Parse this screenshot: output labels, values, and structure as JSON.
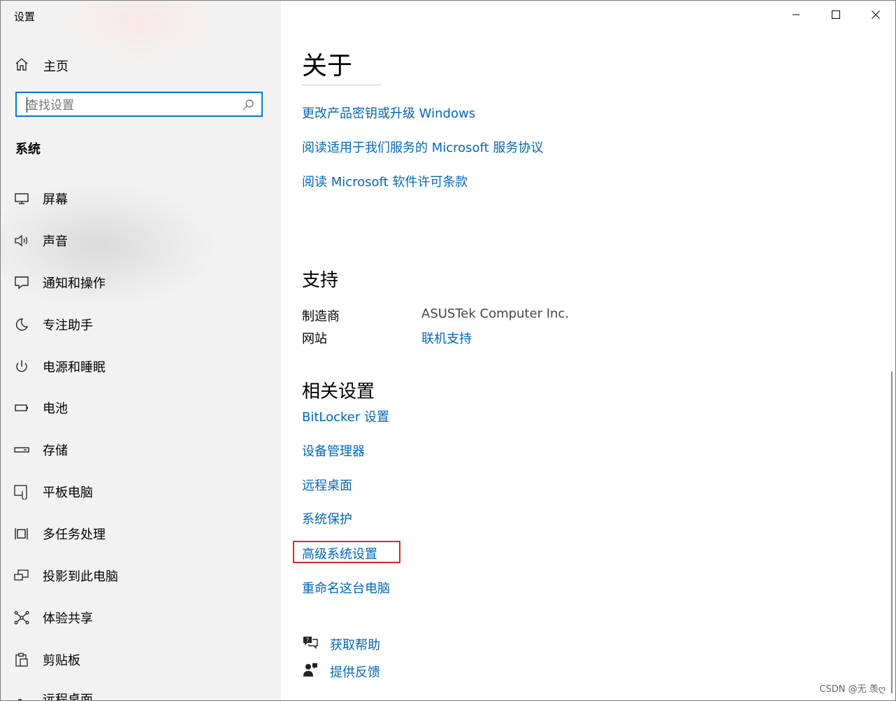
{
  "window": {
    "title": "设置",
    "controls": [
      "minimize",
      "maximize",
      "close"
    ]
  },
  "sidebar": {
    "home_label": "主页",
    "search_placeholder": "查找设置",
    "section_title": "系统",
    "items": [
      {
        "label": "屏幕",
        "icon": "display-icon"
      },
      {
        "label": "声音",
        "icon": "speaker-icon"
      },
      {
        "label": "通知和操作",
        "icon": "notification-icon"
      },
      {
        "label": "专注助手",
        "icon": "moon-icon"
      },
      {
        "label": "电源和睡眠",
        "icon": "power-icon"
      },
      {
        "label": "电池",
        "icon": "battery-icon"
      },
      {
        "label": "存储",
        "icon": "storage-icon"
      },
      {
        "label": "平板电脑",
        "icon": "tablet-icon"
      },
      {
        "label": "多任务处理",
        "icon": "multitask-icon"
      },
      {
        "label": "投影到此电脑",
        "icon": "project-icon"
      },
      {
        "label": "体验共享",
        "icon": "share-icon"
      },
      {
        "label": "剪贴板",
        "icon": "clipboard-icon"
      },
      {
        "label": "远程桌面",
        "icon": "remote-desktop-icon"
      }
    ]
  },
  "main": {
    "about_title": "关于",
    "about_links": [
      "更改产品密钥或升级 Windows",
      "阅读适用于我们服务的 Microsoft 服务协议",
      "阅读 Microsoft 软件许可条款"
    ],
    "support_title": "支持",
    "support": {
      "manufacturer_label": "制造商",
      "manufacturer_value": "ASUSTek Computer Inc.",
      "website_label": "网站",
      "website_link": "联机支持"
    },
    "related_title": "相关设置",
    "related_links": [
      "BitLocker 设置",
      "设备管理器",
      "远程桌面",
      "系统保护",
      "高级系统设置",
      "重命名这台电脑"
    ],
    "help": {
      "get_help": "获取帮助",
      "feedback": "提供反馈"
    }
  },
  "watermark": "CSDN @无 羡ღ",
  "colors": {
    "link": "#0067b8",
    "accent": "#0078d7",
    "highlight": "#e0282e",
    "sidebar_bg": "#f2f2f2"
  }
}
